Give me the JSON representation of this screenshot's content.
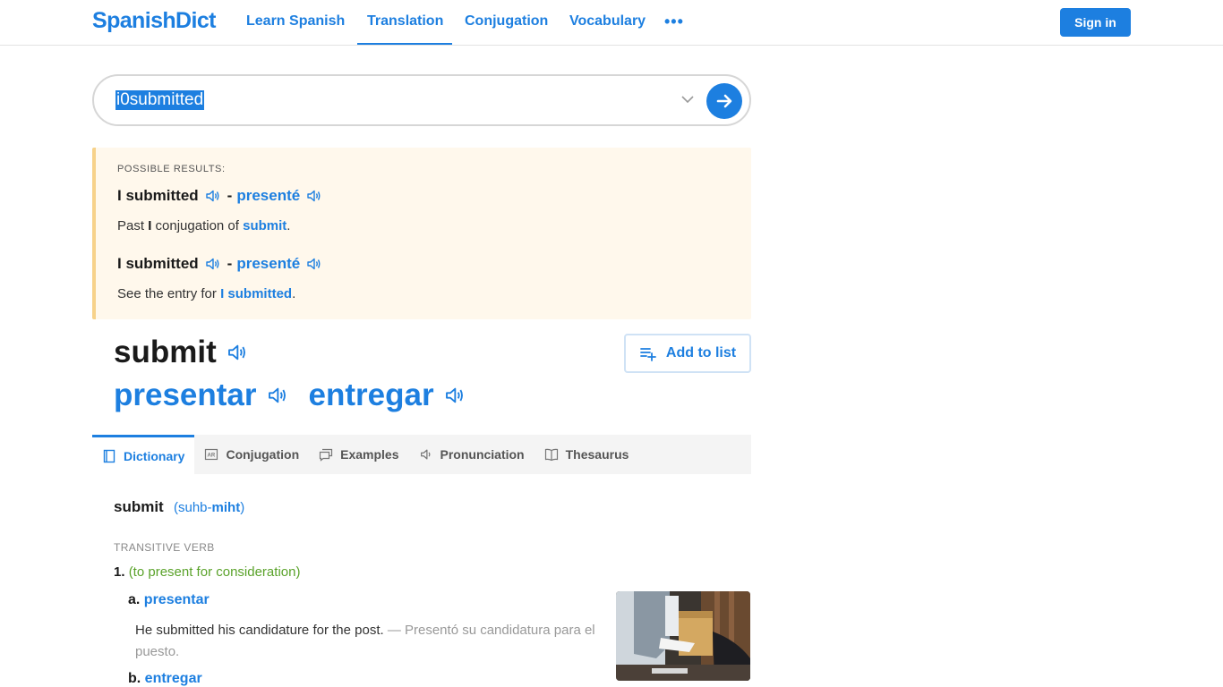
{
  "header": {
    "logo": "SpanishDict",
    "nav": [
      "Learn Spanish",
      "Translation",
      "Conjugation",
      "Vocabulary"
    ],
    "more": "•••",
    "signin": "Sign in"
  },
  "search": {
    "value": "i0submitted"
  },
  "possible": {
    "title": "POSSIBLE RESULTS:",
    "results": [
      {
        "phrase": "I submitted",
        "dash": "-",
        "translation": "presenté",
        "desc_prefix": "Past",
        "desc_bold": "I",
        "desc_middle": "conjugation of",
        "desc_link": "submit",
        "desc_suffix": "."
      },
      {
        "phrase": "I submitted",
        "dash": "-",
        "translation": "presenté",
        "desc_prefix": "See the entry for",
        "desc_link": "I submitted",
        "desc_suffix": "."
      }
    ]
  },
  "entry": {
    "headword": "submit",
    "translations": [
      "presentar",
      "entregar"
    ],
    "add_to_list": "Add to list"
  },
  "tabs": [
    "Dictionary",
    "Conjugation",
    "Examples",
    "Pronunciation",
    "Thesaurus"
  ],
  "dictionary": {
    "word": "submit",
    "pron_open": "(suhb-",
    "pron_bold": "miht",
    "pron_close": ")",
    "pos": "TRANSITIVE VERB",
    "sense_num": "1.",
    "sense_ctx": "(to present for consideration)",
    "subs": [
      {
        "letter": "a.",
        "translation": "presentar"
      },
      {
        "letter": "b.",
        "translation": "entregar"
      }
    ],
    "example_en": "He submitted his candidature for the post.",
    "example_dash": " — ",
    "example_es": "Presentó su candidatura para el puesto."
  },
  "colors": {
    "brand": "#1d7fe0",
    "highlight_bg": "#fff8ec",
    "context_green": "#5aa22a"
  }
}
